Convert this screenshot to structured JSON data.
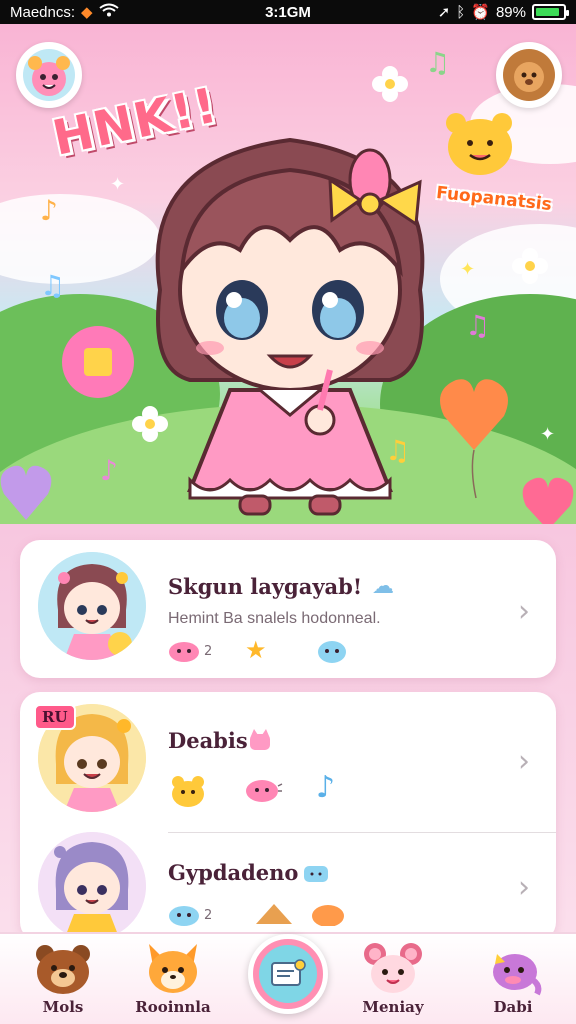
{
  "status_bar": {
    "carrier": "Maedncs:",
    "time": "3:1GM",
    "battery": "89%",
    "battery_level": 0.89
  },
  "hero": {
    "title": "HNK!!",
    "tag": "Fuopanatsis",
    "colors": {
      "sky_top": "#f9b4d4",
      "grass": "#8fd47a",
      "accent": "#ff6a8a"
    }
  },
  "rows": [
    {
      "title": "Skgun laygayab!",
      "subtitle": "Hemint Ba snalels hodonneal.",
      "badge": "",
      "count": "2"
    },
    {
      "title": "Deabis",
      "subtitle": "",
      "badge": "RU",
      "count": ""
    },
    {
      "title": "Gypdadeno",
      "subtitle": "",
      "badge": "",
      "count": "2"
    }
  ],
  "nav": {
    "items": [
      {
        "label": "Mols",
        "icon": "bear-icon"
      },
      {
        "label": "Rooinnla",
        "icon": "fox-icon"
      },
      {
        "label": "",
        "icon": "message-icon"
      },
      {
        "label": "Meniay",
        "icon": "mouse-icon"
      },
      {
        "label": "Dabi",
        "icon": "dragon-icon"
      }
    ]
  }
}
